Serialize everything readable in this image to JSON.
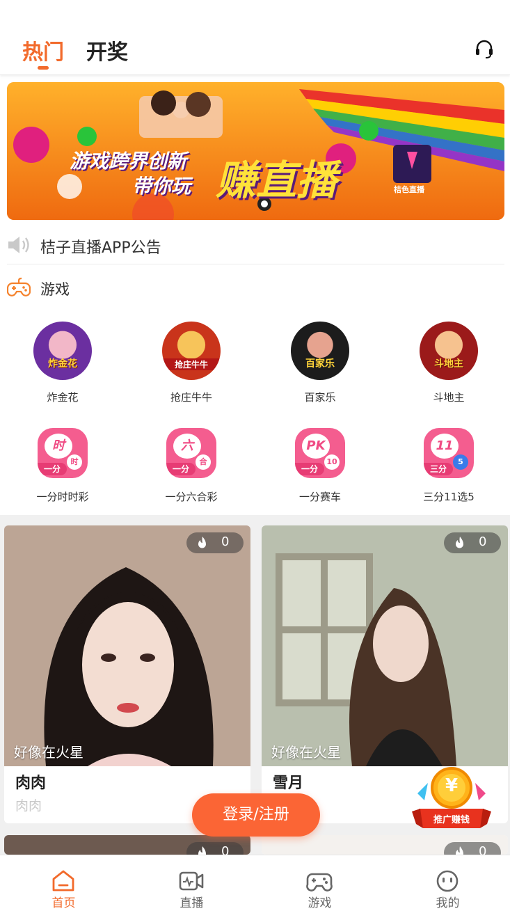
{
  "header": {
    "tabs": [
      {
        "label": "热门",
        "active": true
      },
      {
        "label": "开奖",
        "active": false
      }
    ],
    "support_icon": "headset-icon",
    "accent_color": "#f26a2b"
  },
  "banner": {
    "line1": "游戏跨界创新",
    "line2": "带你玩",
    "highlight": "赚直播",
    "logo_text": "桔色直播"
  },
  "notice": {
    "icon": "speaker-icon",
    "text": "桔子直播APP公告"
  },
  "games_section": {
    "icon": "gamepad-icon",
    "title": "游戏",
    "games": [
      {
        "label": "炸金花",
        "badge": "炸金花"
      },
      {
        "label": "抢庄牛牛",
        "badge": "抢庄牛牛"
      },
      {
        "label": "百家乐",
        "badge": "百家乐"
      },
      {
        "label": "斗地主",
        "badge": "斗地主"
      }
    ],
    "lotteries": [
      {
        "label": "一分时时彩",
        "ball": "时",
        "tag": "一分",
        "mini": "时"
      },
      {
        "label": "一分六合彩",
        "ball": "六",
        "tag": "一分",
        "mini": "合"
      },
      {
        "label": "一分赛车",
        "ball": "PK",
        "tag": "一分",
        "mini": "10"
      },
      {
        "label": "三分11选5",
        "ball": "11",
        "tag": "三分",
        "mini": "5"
      }
    ]
  },
  "streams": [
    {
      "caption": "好像在火星",
      "name": "肉肉",
      "sub": "肉肉",
      "viewers": "0"
    },
    {
      "caption": "好像在火星",
      "name": "雪月",
      "sub": "",
      "viewers": "0"
    },
    {
      "viewers": "0"
    },
    {
      "viewers": "0"
    }
  ],
  "login_button": "登录/注册",
  "promo": {
    "label": "推广赚钱",
    "symbol": "¥"
  },
  "bottom_nav": [
    {
      "label": "首页",
      "icon": "home-icon",
      "active": true
    },
    {
      "label": "直播",
      "icon": "live-icon",
      "active": false
    },
    {
      "label": "游戏",
      "icon": "gamepad-icon",
      "active": false
    },
    {
      "label": "我的",
      "icon": "profile-icon",
      "active": false
    }
  ]
}
